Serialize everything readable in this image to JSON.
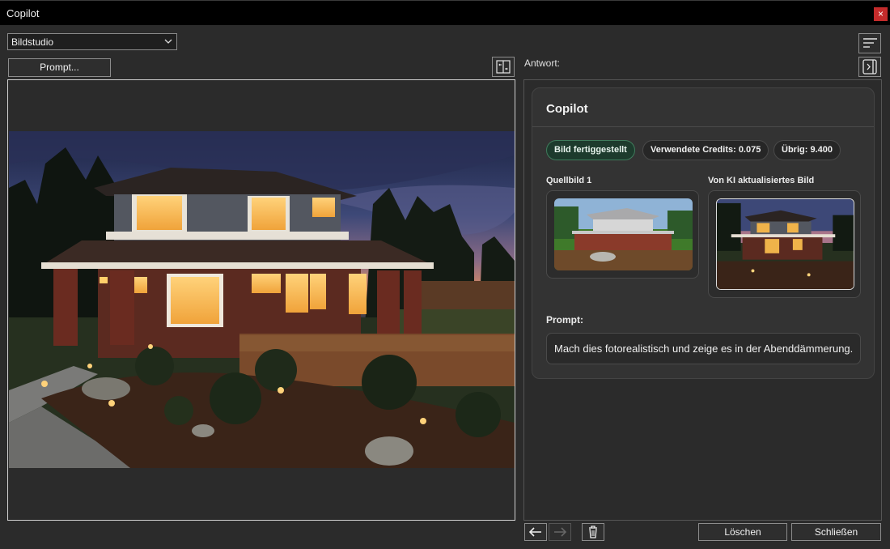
{
  "window": {
    "title": "Copilot",
    "close_glyph": "×"
  },
  "mode_select": {
    "value": "Bildstudio"
  },
  "toolbar": {
    "prompt_button": "Prompt..."
  },
  "response": {
    "label": "Antwort:",
    "card_title": "Copilot",
    "status_chip": "Bild fertiggestellt",
    "credits_chip": "Verwendete Credits: 0.075",
    "remaining_chip": "Übrig: 9.400",
    "source_label": "Quellbild 1",
    "updated_label": "Von KI aktualisiertes Bild",
    "prompt_label": "Prompt:",
    "prompt_text": "Mach dies fotorealistisch und zeige es in der Abenddämmerung."
  },
  "footer": {
    "delete_button": "Löschen",
    "close_button": "Schließen"
  },
  "colors": {
    "accent_success": "#3f7c5c",
    "close_red": "#c42b2b",
    "window_bg": "#2b2b2b"
  },
  "icons": [
    "close-icon",
    "chevron-down-icon",
    "sort-lines-icon",
    "swap-panels-icon",
    "panel-toggle-icon",
    "arrow-left-icon",
    "arrow-right-icon",
    "trash-icon"
  ]
}
